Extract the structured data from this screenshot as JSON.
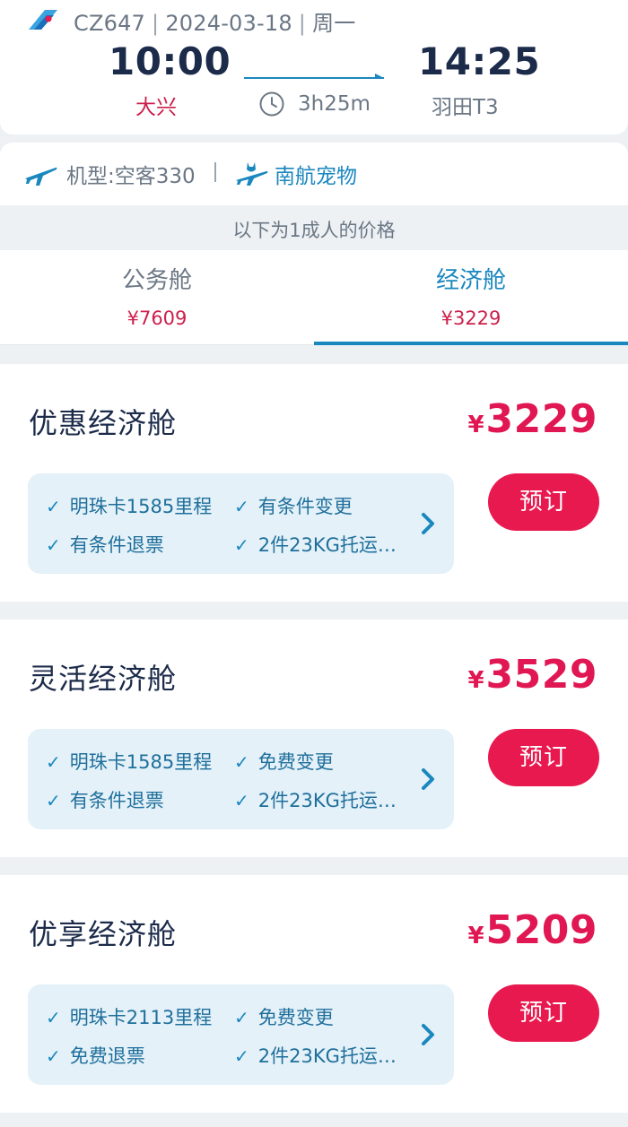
{
  "flight": {
    "number": "CZ647",
    "date": "2024-03-18",
    "weekday": "周一",
    "departure_time": "10:00",
    "departure_airport": "大兴",
    "arrival_time": "14:25",
    "arrival_airport": "羽田T3",
    "duration": "3h25m",
    "airline_logo_icon": "airline-logo-icon"
  },
  "info": {
    "aircraft": "机型:空客330",
    "pet_service": "南航宠物"
  },
  "price_note": "以下为1成人的价格",
  "tabs": [
    {
      "name": "公务舱",
      "price": "¥7609",
      "selected": false
    },
    {
      "name": "经济舱",
      "price": "¥3229",
      "selected": true
    }
  ],
  "fares": [
    {
      "name": "优惠经济舱",
      "currency": "¥",
      "price": "3229",
      "perks": [
        "明珠卡1585里程",
        "有条件变更",
        "有条件退票",
        "2件23KG托运…"
      ],
      "book_label": "预订"
    },
    {
      "name": "灵活经济舱",
      "currency": "¥",
      "price": "3529",
      "perks": [
        "明珠卡1585里程",
        "免费变更",
        "有条件退票",
        "2件23KG托运…"
      ],
      "book_label": "预订"
    },
    {
      "name": "优享经济舱",
      "currency": "¥",
      "price": "5209",
      "perks": [
        "明珠卡2113里程",
        "免费变更",
        "免费退票",
        "2件23KG托运…"
      ],
      "book_label": "预订"
    }
  ],
  "colors": {
    "accent": "#1a87bf",
    "price": "#e01752",
    "book_button": "#e8194f",
    "perk_bg": "#e4f1f8"
  }
}
